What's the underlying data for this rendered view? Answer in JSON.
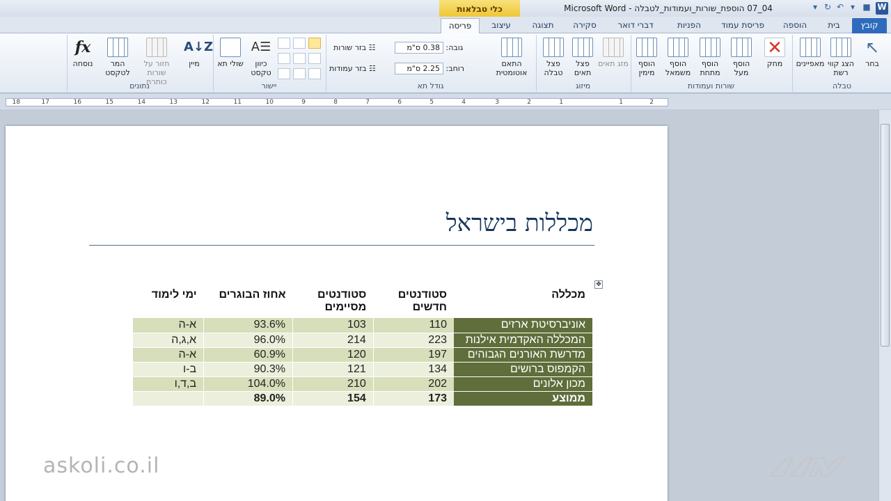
{
  "window": {
    "title": "04_07 הוספת_שורות_ועמודות_לטבלה - Microsoft Word",
    "context_tab_group": "כלי טבלאות"
  },
  "tabs": [
    {
      "label": "קובץ"
    },
    {
      "label": "בית"
    },
    {
      "label": "הוספה"
    },
    {
      "label": "פריסת עמוד"
    },
    {
      "label": "הפניות"
    },
    {
      "label": "דברי דואר"
    },
    {
      "label": "סקירה"
    },
    {
      "label": "תצוגה"
    },
    {
      "label": "עיצוב"
    },
    {
      "label": "פריסה"
    }
  ],
  "ribbon": {
    "table_group": {
      "label": "טבלה",
      "select": "בחר",
      "gridlines": "הצג קווי רשת",
      "properties": "מאפיינים"
    },
    "rows_cols_group": {
      "label": "שורות ועמודות",
      "delete": "מחק",
      "insert_above": "הוסף מעל",
      "insert_below": "הוסף מתחת",
      "insert_left": "הוסף משמאל",
      "insert_right": "הוסף מימין"
    },
    "merge_group": {
      "label": "מיזוג",
      "merge": "מזג תאים",
      "split_cells": "פצל תאים",
      "split_table": "פצל טבלה"
    },
    "cell_size_group": {
      "label": "גודל תא",
      "autofit": "התאם אוטומטית",
      "height_label": "גובה:",
      "height_value": "0.38 ס\"מ",
      "width_label": "רוחב:",
      "width_value": "2.25 ס\"מ",
      "distribute_rows": "בזר שורות",
      "distribute_cols": "בזר עמודות"
    },
    "alignment_group": {
      "label": "יישור",
      "text_direction": "כיוון טקסט",
      "cell_margins": "שולי תא"
    },
    "data_group": {
      "label": "נתונים",
      "sort": "מיין",
      "repeat_header": "חזור על שורות כותרת",
      "convert": "המר לטקסט",
      "formula": "נוסחה"
    }
  },
  "ruler": {
    "ticks": [
      "2",
      "1",
      "1",
      "2",
      "3",
      "4",
      "5",
      "6",
      "7",
      "8",
      "9",
      "10",
      "11",
      "12",
      "13",
      "14",
      "15",
      "16",
      "17",
      "18"
    ]
  },
  "document": {
    "title": "מכללות בישראל",
    "table": {
      "headers": [
        "מכללה",
        "סטודנטים חדשים",
        "סטודנטים מסיימים",
        "אחוז הבוגרים",
        "ימי לימוד"
      ],
      "rows": [
        {
          "college": "אוניברסיטת ארזים",
          "new": "110",
          "grad": "103",
          "pct": "93.6%",
          "days": "א-ה"
        },
        {
          "college": "המכללה האקדמית אילנות",
          "new": "223",
          "grad": "214",
          "pct": "96.0%",
          "days": "א,ג,ה"
        },
        {
          "college": "מדרשת האורנים הגבוהים",
          "new": "197",
          "grad": "120",
          "pct": "60.9%",
          "days": "א-ה"
        },
        {
          "college": "הקמפוס ברושים",
          "new": "134",
          "grad": "121",
          "pct": "90.3%",
          "days": "ב-ו"
        },
        {
          "college": "מכון אלונים",
          "new": "202",
          "grad": "210",
          "pct": "104.0%",
          "days": "ב,ד,ו"
        }
      ],
      "average": {
        "college": "ממוצע",
        "new": "173",
        "grad": "154",
        "pct": "89.0%",
        "days": ""
      }
    }
  },
  "watermark": "askoli.co.il"
}
